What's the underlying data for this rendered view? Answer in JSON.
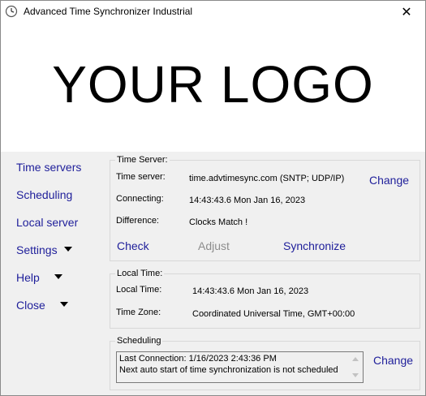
{
  "window": {
    "title": "Advanced Time Synchronizer Industrial",
    "close_glyph": "✕"
  },
  "logo": {
    "text": "YOUR LOGO"
  },
  "nav": {
    "items": [
      {
        "label": "Time servers",
        "has_dropdown": false
      },
      {
        "label": "Scheduling",
        "has_dropdown": false
      },
      {
        "label": "Local server",
        "has_dropdown": false
      },
      {
        "label": "Settings",
        "has_dropdown": true
      },
      {
        "label": "Help",
        "has_dropdown": true
      },
      {
        "label": "Close",
        "has_dropdown": true
      }
    ]
  },
  "time_server": {
    "group_title": "Time Server:",
    "server_label": "Time server:",
    "server_value": "time.advtimesync.com (SNTP; UDP/IP)",
    "change_label": "Change",
    "connecting_label": "Connecting:",
    "connecting_value": "14:43:43.6 Mon Jan 16, 2023",
    "difference_label": "Difference:",
    "difference_value": "Clocks Match !",
    "check_label": "Check",
    "adjust_label": "Adjust",
    "synchronize_label": "Synchronize"
  },
  "local_time": {
    "group_title": "Local Time:",
    "local_label": "Local Time:",
    "local_value": "14:43:43.6 Mon Jan 16, 2023",
    "zone_label": "Time Zone:",
    "zone_value": "Coordinated Universal Time, GMT+00:00"
  },
  "scheduling": {
    "group_title": "Scheduling",
    "lines": [
      "Last Connection: 1/16/2023 2:43:36 PM",
      "Next auto start of time synchronization is not scheduled"
    ],
    "change_label": "Change"
  },
  "colors": {
    "link": "#1e1e9a",
    "panel_bg": "#f0f0f0",
    "disabled": "#8d8d8d"
  }
}
